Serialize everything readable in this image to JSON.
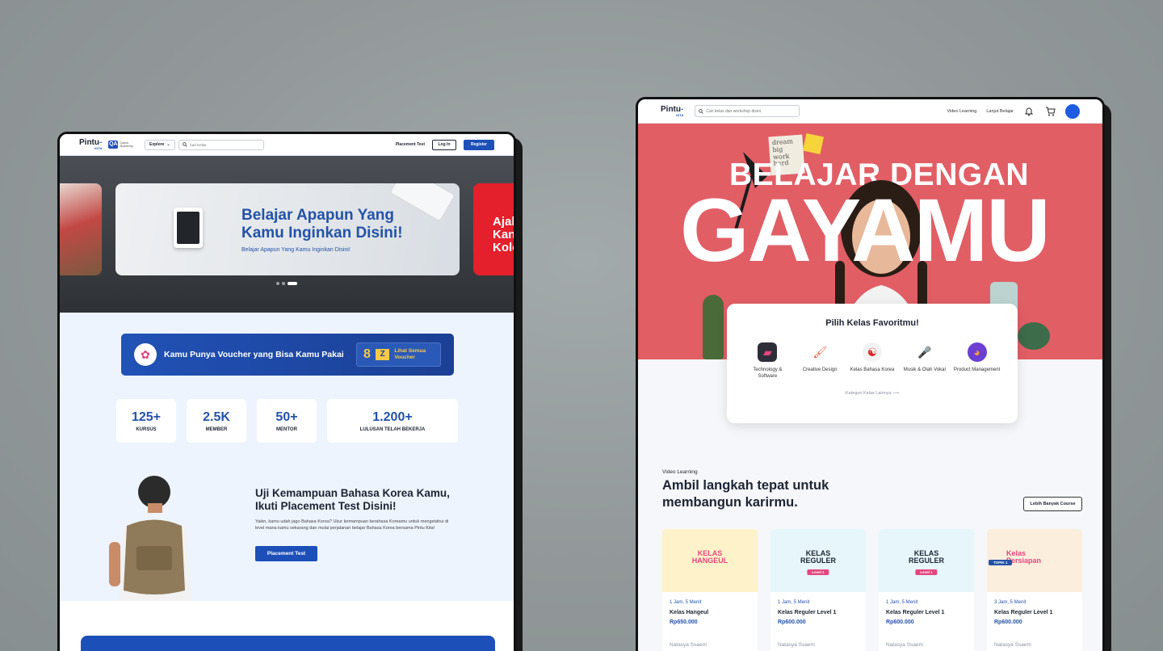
{
  "colors": {
    "primary": "#1d4fb8",
    "hero_red": "#e15e65",
    "voucher_yellow": "#f7c948"
  },
  "left": {
    "nav": {
      "logo": "Pintu",
      "logo_sub": "KITA",
      "partner": "Qajoo\nAcademy",
      "explore": "Explore",
      "search_placeholder": "Cari Kelas",
      "placement_link": "Placement Test",
      "login": "Log In",
      "register": "Register"
    },
    "hero": {
      "title": "Belajar Apapun Yang Kamu Inginkan Disini!",
      "subtitle": "Belajar Apapun Yang Kamu Inginkan Disini!",
      "next_slide": "Ajal\nKan\nKolo"
    },
    "voucher": {
      "text": "Kamu Punya Voucher yang Bisa Kamu Pakai",
      "count": "8",
      "link": "Lihat Semua Voucher"
    },
    "stats": [
      {
        "value": "125+",
        "label": "KURSUS"
      },
      {
        "value": "2.5K",
        "label": "MEMBER"
      },
      {
        "value": "50+",
        "label": "MENTOR"
      },
      {
        "value": "1.200+",
        "label": "LULUSAN TELAH BEKERJA"
      }
    ],
    "placement": {
      "title": "Uji Kemampuan Bahasa Korea Kamu, Ikuti Placement Test Disini!",
      "desc": "Yakin, kamu udah jago Bahasa Korea? Ukur kemampuan berahasa Koreamu untuk mengetahui di level mana kamu sekarang dan mulai perjalanan belajar Bahasa Korea bersama Pintu Kita!",
      "button": "Placement Test"
    }
  },
  "right": {
    "nav": {
      "search_placeholder": "Cari kelas dan workshop disini",
      "video_learning": "Video Learning",
      "continue": "Lanjut Belajar"
    },
    "hero": {
      "line1": "BELAJAR DENGAN",
      "line2": "GAYAMU",
      "note": "dream big work hard"
    },
    "categories": {
      "title": "Pilih Kelas Favoritmu!",
      "items": [
        {
          "label": "Technology & Software",
          "icon": "laptop-icon"
        },
        {
          "label": "Creative Design",
          "icon": "paint-roller-icon"
        },
        {
          "label": "Kelas Bahasa Korea",
          "icon": "korea-flag-icon"
        },
        {
          "label": "Musik & Olah Vokal",
          "icon": "microphone-icon"
        },
        {
          "label": "Product Management",
          "icon": "chart-icon"
        }
      ],
      "more": "Kategori Kelas Lainnya"
    },
    "section": {
      "tag": "Video Learning",
      "title": "Ambil langkah tepat untuk membangun karirmu.",
      "more_button": "Lebih Banyak Course"
    },
    "courses": [
      {
        "thumb": "KELAS\nHANGEUL",
        "level": "",
        "duration": "1 Jam, 5 Menit",
        "name": "Kelas Hangeul",
        "price": "Rp650.000",
        "author": "Natasya Ssaem"
      },
      {
        "thumb": "KELAS\nREGULER",
        "level": "Level 1",
        "duration": "1 Jam, 5 Menit",
        "name": "Kelas Reguler Level 1",
        "price": "Rp600.000",
        "author": "Natasya Ssaem"
      },
      {
        "thumb": "KELAS\nREGULER",
        "level": "Level 1",
        "duration": "1 Jam, 5 Menit",
        "name": "Kelas Reguler Level 1",
        "price": "Rp600.000",
        "author": "Natasya Ssaem"
      },
      {
        "thumb": "Kelas\nPersiapan",
        "level": "TOPIK 1",
        "duration": "3 Jam, 5 Menit",
        "name": "Kelas Reguler Level 1",
        "price": "Rp600.000",
        "author": "Natasya Ssaem"
      }
    ]
  }
}
